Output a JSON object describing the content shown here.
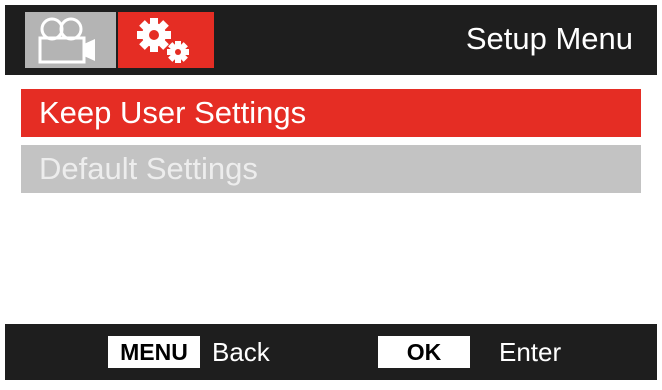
{
  "header": {
    "title": "Setup Menu",
    "tabs": [
      {
        "icon": "video-camera-icon",
        "active": false,
        "color": "#b4b4b4"
      },
      {
        "icon": "gears-icon",
        "active": true,
        "color": "#e52d24"
      }
    ]
  },
  "menu": {
    "items": [
      {
        "label": "Keep User Settings",
        "selected": true
      },
      {
        "label": "Default Settings",
        "selected": false
      }
    ]
  },
  "footer": {
    "menu_key": "MENU",
    "menu_action": "Back",
    "ok_key": "OK",
    "ok_action": "Enter"
  },
  "colors": {
    "accent": "#e52d24",
    "bar": "#1e1e1e",
    "inactive": "#c3c3c3"
  }
}
